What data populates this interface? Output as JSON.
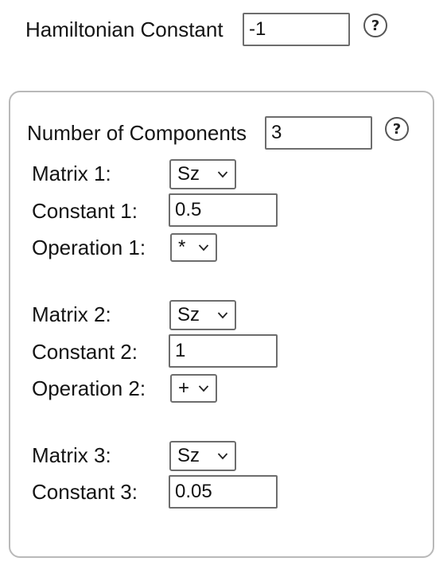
{
  "hamiltonian": {
    "label": "Hamiltonian Constant",
    "value": "-1",
    "help_glyph": "?"
  },
  "components_panel": {
    "count_label": "Number of Components",
    "count_value": "3",
    "help_glyph": "?",
    "components": [
      {
        "matrix_label": "Matrix 1:",
        "matrix_value": "Sz",
        "constant_label": "Constant 1:",
        "constant_value": "0.5",
        "operation_label": "Operation 1:",
        "operation_value": "*"
      },
      {
        "matrix_label": "Matrix 2:",
        "matrix_value": "Sz",
        "constant_label": "Constant 2:",
        "constant_value": "1",
        "operation_label": "Operation 2:",
        "operation_value": "+"
      },
      {
        "matrix_label": "Matrix 3:",
        "matrix_value": "Sz",
        "constant_label": "Constant 3:",
        "constant_value": "0.05"
      }
    ]
  },
  "icons": {
    "help": "question-circle-icon",
    "dropdown": "chevron-down-icon"
  }
}
